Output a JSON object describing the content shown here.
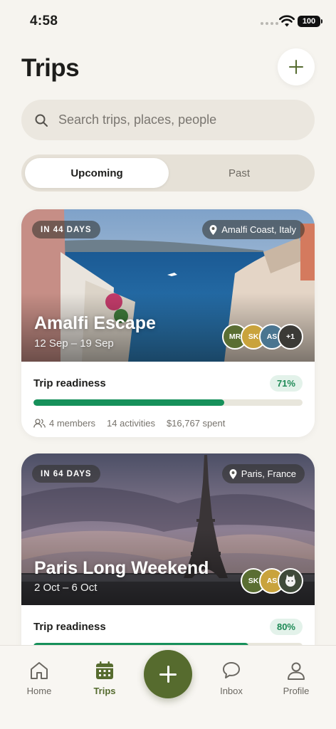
{
  "status_bar": {
    "time": "4:58",
    "battery": "100"
  },
  "header": {
    "title": "Trips",
    "add_button": "add-trip"
  },
  "search": {
    "placeholder": "Search trips, places, people",
    "value": ""
  },
  "tabs": [
    {
      "label": "Upcoming",
      "active": true
    },
    {
      "label": "Past",
      "active": false
    }
  ],
  "trips": [
    {
      "countdown": "IN 44 DAYS",
      "location": "Amalfi Coast, Italy",
      "name": "Amalfi Escape",
      "dates": "12 Sep – 19 Sep",
      "avatars": [
        {
          "initials": "MR",
          "color": "#5a6e33"
        },
        {
          "initials": "SK",
          "color": "#c9a33c"
        },
        {
          "initials": "AS",
          "color": "#4a7590"
        },
        {
          "initials": "+1",
          "color": "#3b3a36"
        }
      ],
      "readiness_label": "Trip readiness",
      "readiness_percent": "71%",
      "readiness_value": 0.71,
      "members": "4 members",
      "activities": "14 activities",
      "spent": "$16,767 spent"
    },
    {
      "countdown": "IN 64 DAYS",
      "location": "Paris, France",
      "name": "Paris Long Weekend",
      "dates": "2 Oct – 6 Oct",
      "avatars": [
        {
          "initials": "SK",
          "color": "#5a6e33"
        },
        {
          "initials": "AS",
          "color": "#c9a33c"
        },
        {
          "initials": "",
          "color": "#3f4a3a",
          "photo": true
        }
      ],
      "readiness_label": "Trip readiness",
      "readiness_percent": "80%",
      "readiness_value": 0.8
    }
  ],
  "bottom_nav": [
    {
      "label": "Home",
      "icon": "home-icon",
      "active": false
    },
    {
      "label": "Trips",
      "icon": "calendar-icon",
      "active": true
    },
    {
      "label": "",
      "icon": "plus-icon",
      "active": false
    },
    {
      "label": "Inbox",
      "icon": "chat-icon",
      "active": false
    },
    {
      "label": "Profile",
      "icon": "profile-icon",
      "active": false
    }
  ],
  "colors": {
    "accent": "#566b2e",
    "progress": "#16905a",
    "background": "#f6f4ef"
  }
}
